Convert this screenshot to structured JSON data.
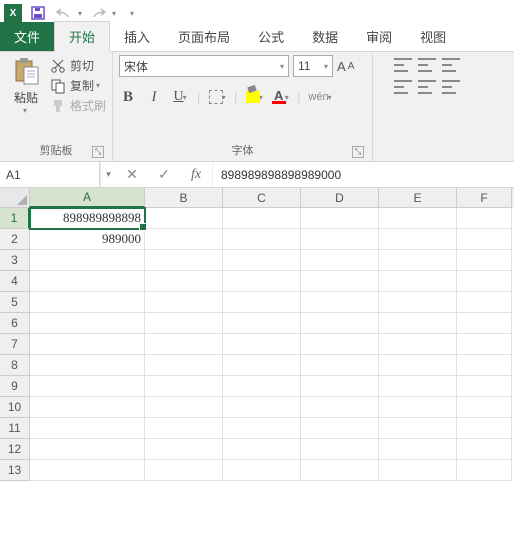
{
  "qat": {
    "save": "保存",
    "undo": "撤销",
    "redo": "重做"
  },
  "tabs": {
    "file": "文件",
    "home": "开始",
    "insert": "插入",
    "page_layout": "页面布局",
    "formulas": "公式",
    "data": "数据",
    "review": "审阅",
    "view": "视图"
  },
  "clipboard": {
    "paste": "粘贴",
    "cut": "剪切",
    "copy": "复制",
    "format_painter": "格式刷",
    "group_label": "剪贴板"
  },
  "font": {
    "name": "宋体",
    "size": "11",
    "bold": "B",
    "italic": "I",
    "underline": "U",
    "font_color_letter": "A",
    "wen": "wén",
    "group_label": "字体",
    "inc_a": "A",
    "dec_a": "A"
  },
  "formula_bar": {
    "name_box": "A1",
    "cancel": "✕",
    "enter": "✓",
    "fx": "fx",
    "value": "898989898898989000"
  },
  "columns": [
    "A",
    "B",
    "C",
    "D",
    "E",
    "F"
  ],
  "rows": [
    {
      "n": 1,
      "A_display": "898989898898"
    },
    {
      "n": 2,
      "A_display": "989000"
    },
    {
      "n": 3
    },
    {
      "n": 4
    },
    {
      "n": 5
    },
    {
      "n": 6
    },
    {
      "n": 7
    },
    {
      "n": 8
    },
    {
      "n": 9
    },
    {
      "n": 10
    },
    {
      "n": 11
    },
    {
      "n": 12
    },
    {
      "n": 13
    }
  ],
  "active_cell": "A1",
  "cell_data": {
    "A1": "898989898898989000"
  }
}
